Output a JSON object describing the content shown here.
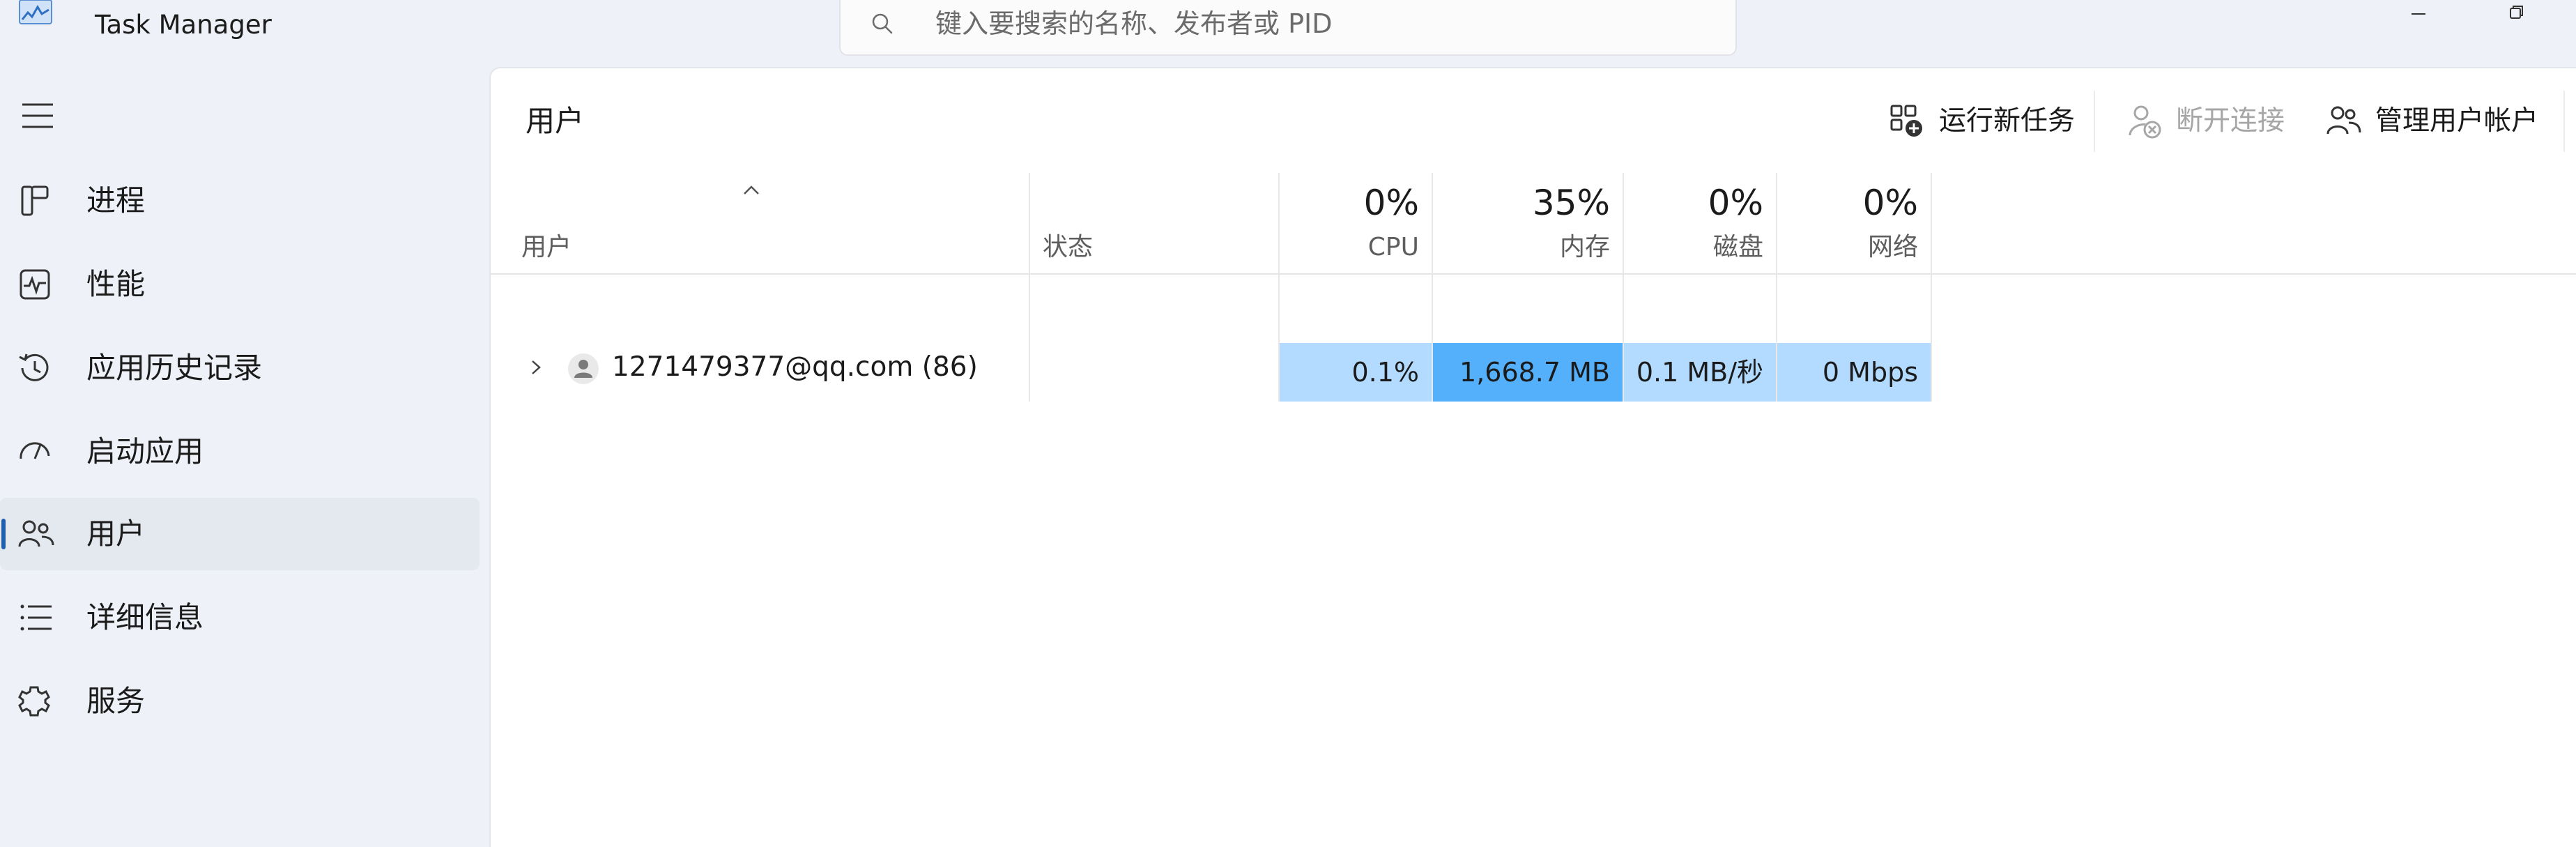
{
  "window": {
    "title": "Task Manager",
    "icon": "task-manager-app-icon"
  },
  "search": {
    "placeholder": "键入要搜索的名称、发布者或 PID",
    "icon": "search-icon"
  },
  "sidebar": {
    "menu_icon": "hamburger-icon",
    "items": [
      {
        "label": "进程",
        "icon": "processes-icon",
        "active": false
      },
      {
        "label": "性能",
        "icon": "performance-icon",
        "active": false
      },
      {
        "label": "应用历史记录",
        "icon": "app-history-icon",
        "active": false
      },
      {
        "label": "启动应用",
        "icon": "startup-apps-icon",
        "active": false
      },
      {
        "label": "用户",
        "icon": "users-icon",
        "active": true
      },
      {
        "label": "详细信息",
        "icon": "details-icon",
        "active": false
      },
      {
        "label": "服务",
        "icon": "services-icon",
        "active": false
      }
    ]
  },
  "main": {
    "title": "用户",
    "toolbar": {
      "run_new_task": "运行新任务",
      "disconnect": "断开连接",
      "manage_accounts": "管理用户帐户"
    },
    "table": {
      "columns": {
        "user": "用户",
        "status": "状态",
        "cpu": {
          "percent": "0%",
          "label": "CPU"
        },
        "memory": {
          "percent": "35%",
          "label": "内存"
        },
        "disk": {
          "percent": "0%",
          "label": "磁盘"
        },
        "network": {
          "percent": "0%",
          "label": "网络"
        }
      },
      "rows": [
        {
          "user": "1271479377@qq.com (86)",
          "status": "",
          "cpu": "0.1%",
          "memory": "1,668.7 MB",
          "disk": "0.1 MB/秒",
          "network": "0 Mbps"
        }
      ]
    }
  },
  "colors": {
    "accent": "#1f5fae",
    "heat_low": "#b3dbff",
    "heat_mid": "#55b0fb",
    "sidebar_bg": "#eef1f7",
    "panel_bg": "#ffffff"
  }
}
